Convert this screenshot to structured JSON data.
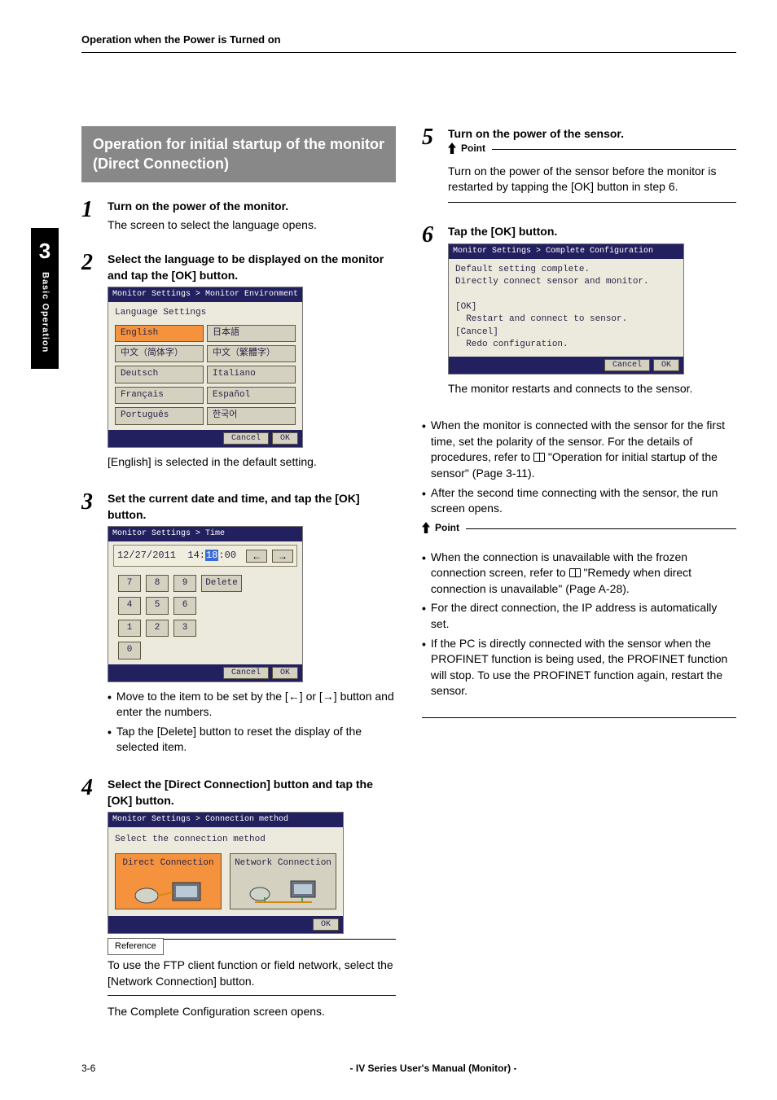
{
  "header": {
    "running_head": "Operation when the Power is Turned on"
  },
  "chapter": {
    "number": "3",
    "label": "Basic Operation"
  },
  "section_title": "Operation for initial startup of the monitor (Direct Connection)",
  "steps": {
    "s1": {
      "num": "1",
      "title": "Turn on the power of the monitor.",
      "text": "The screen to select the language opens."
    },
    "s2": {
      "num": "2",
      "title": "Select the language to be displayed on the monitor and tap the [OK] button.",
      "caption": "[English] is selected in the default setting.",
      "screen": {
        "titlebar": "Monitor Settings > Monitor Environment > Language",
        "heading": "Language Settings",
        "langs": [
          "English",
          "日本語",
          "中文（简体字）",
          "中文（繁體字）",
          "Deutsch",
          "Italiano",
          "Français",
          "Español",
          "Português",
          "한국어"
        ],
        "selected_index": 0,
        "cancel": "Cancel",
        "ok": "OK"
      }
    },
    "s3": {
      "num": "3",
      "title": "Set the current date and time, and tap the [OK] button.",
      "bullets": [
        "Move to the item to be set by the [←] or [→] button and enter the numbers.",
        "Tap the [Delete] button to reset the display of the selected item."
      ],
      "screen": {
        "titlebar": "Monitor Settings > Time",
        "date": "12/27/2011",
        "time_pre": "14:",
        "time_hl": "18",
        "time_post": ":00",
        "arrow_left": "←",
        "arrow_right": "→",
        "keys": [
          "7",
          "8",
          "9",
          "Delete",
          "4",
          "5",
          "6",
          "",
          "1",
          "2",
          "3",
          "",
          "0",
          "",
          "",
          ""
        ],
        "cancel": "Cancel",
        "ok": "OK"
      }
    },
    "s4": {
      "num": "4",
      "title": "Select the [Direct Connection] button and tap the [OK] button.",
      "reference_label": "Reference",
      "reference_text": "To use the FTP client function or field network, select the [Network Connection] button.",
      "after_text": "The Complete Configuration screen opens.",
      "screen": {
        "titlebar": "Monitor Settings > Connection method",
        "heading": "Select the connection method",
        "direct": "Direct Connection",
        "network": "Network Connection",
        "ok": "OK"
      }
    },
    "s5": {
      "num": "5",
      "title": "Turn on the power of the sensor.",
      "point_label": "Point",
      "point_text": "Turn on the power of the sensor before the monitor is restarted by tapping the [OK] button in step 6."
    },
    "s6": {
      "num": "6",
      "title": "Tap the [OK] button.",
      "caption": "The monitor restarts and connects to the sensor.",
      "screen": {
        "titlebar": "Monitor Settings > Complete Configuration",
        "msg": "Default setting complete.\nDirectly connect sensor and monitor.\n\n[OK]\n  Restart and connect to sensor.\n[Cancel]\n  Redo configuration.",
        "cancel": "Cancel",
        "ok": "OK"
      }
    }
  },
  "after_bullets": [
    "When the monitor is connected with the sensor for the first time, set the polarity of the sensor. For the details of procedures, refer to 📖 \"Operation for initial startup of the sensor\" (Page 3-11).",
    "After the second time connecting with the sensor, the run screen opens."
  ],
  "final_point": {
    "label": "Point",
    "bullets": [
      "When the connection is unavailable with the frozen connection screen, refer to 📖 \"Remedy when direct connection is unavailable\" (Page A-28).",
      "For the direct connection, the IP address is automatically set.",
      "If the PC is directly connected with the sensor when the PROFINET function is being used, the PROFINET function will stop. To use the PROFINET function again, restart the sensor."
    ]
  },
  "footer": {
    "page": "3-6",
    "title": "- IV Series User's Manual (Monitor) -"
  }
}
